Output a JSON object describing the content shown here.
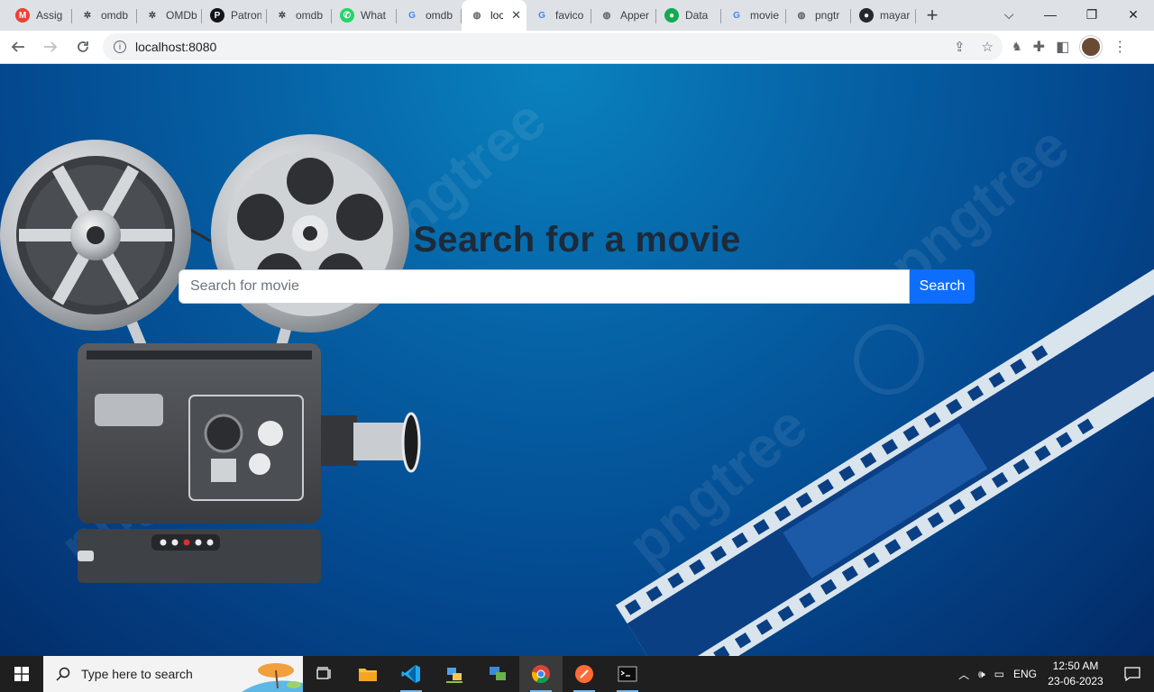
{
  "browser": {
    "tabs": [
      {
        "label": "Assig",
        "icon": "gmail-icon",
        "color": "#ea4335",
        "glyph": "M"
      },
      {
        "label": "omdb",
        "icon": "omdb-icon",
        "color": "#3c4043",
        "glyph": "✲"
      },
      {
        "label": "OMDb",
        "icon": "omdb-icon",
        "color": "#3c4043",
        "glyph": "✲"
      },
      {
        "label": "Patron",
        "icon": "patreon-icon",
        "color": "#141518",
        "glyph": "P"
      },
      {
        "label": "omdb",
        "icon": "omdb-icon",
        "color": "#3c4043",
        "glyph": "✲"
      },
      {
        "label": "What",
        "icon": "whatsapp-icon",
        "color": "#25d366",
        "glyph": "✆"
      },
      {
        "label": "omdb",
        "icon": "google-icon",
        "color": "#4285f4",
        "glyph": "G"
      },
      {
        "label": "loc",
        "icon": "globe-icon",
        "color": "#5f6368",
        "glyph": "◍",
        "active": true
      },
      {
        "label": "favico",
        "icon": "google-icon",
        "color": "#4285f4",
        "glyph": "G"
      },
      {
        "label": "Apper",
        "icon": "globe-icon",
        "color": "#5f6368",
        "glyph": "◍"
      },
      {
        "label": "Data",
        "icon": "mongodb-icon",
        "color": "#13aa52",
        "glyph": "●"
      },
      {
        "label": "movie",
        "icon": "google-icon",
        "color": "#4285f4",
        "glyph": "G"
      },
      {
        "label": "pngtr",
        "icon": "globe-icon",
        "color": "#5f6368",
        "glyph": "◍"
      },
      {
        "label": "mayar",
        "icon": "github-icon",
        "color": "#24292f",
        "glyph": "●"
      }
    ],
    "url": "localhost:8080"
  },
  "page": {
    "heading": "Search for a movie",
    "search_placeholder": "Search for movie",
    "search_value": "",
    "search_button": "Search",
    "watermark": "pngtree"
  },
  "taskbar": {
    "search_placeholder": "Type here to search",
    "language": "ENG",
    "time": "12:50 AM",
    "date": "23-06-2023"
  }
}
